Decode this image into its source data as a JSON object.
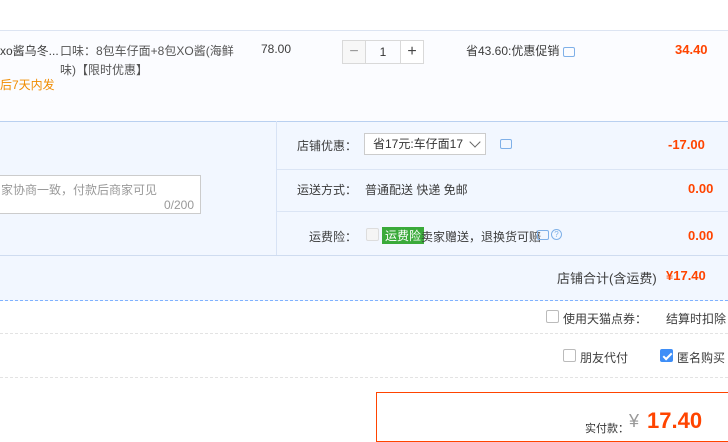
{
  "item": {
    "title": "xo酱乌冬...",
    "promise": "后7天内发",
    "spec": "口味：8包车仔面+8包XO酱(海鲜",
    "spec2": "味)【限时优惠】",
    "price": "78.00",
    "quantity": "1",
    "minus": "−",
    "plus": "+",
    "saving": "省43.60:优惠促销",
    "subtotal": "34.40"
  },
  "shop": {
    "discount_label": "店铺优惠：",
    "discount_value": "省17元:车仔面17",
    "discount_amount": "-17.00",
    "shipping_label": "运送方式：",
    "shipping_value": "普通配送 快递 免邮",
    "shipping_amount": "0.00",
    "insurance_label": "运费险：",
    "insurance_tag": "运费险",
    "insurance_desc": "卖家赠送，退换货可赔",
    "insurance_amount": "0.00",
    "message_placeholder": "家协商一致，付款后商家可见",
    "message_counter": "0/200",
    "total_label": "店铺合计(含运费)",
    "total_value": "¥17.40"
  },
  "options": {
    "tmall_points": "使用天猫点券：",
    "tmall_points_note": "结算时扣除",
    "friend_pay": "朋友代付",
    "anonymous": "匿名购买"
  },
  "payment": {
    "label": "实付款：",
    "currency": "¥",
    "amount": "17.40"
  },
  "colors": {
    "accent": "#ff4400",
    "link_blue": "#3e8ef7",
    "tag_green": "#3aaa3a"
  }
}
